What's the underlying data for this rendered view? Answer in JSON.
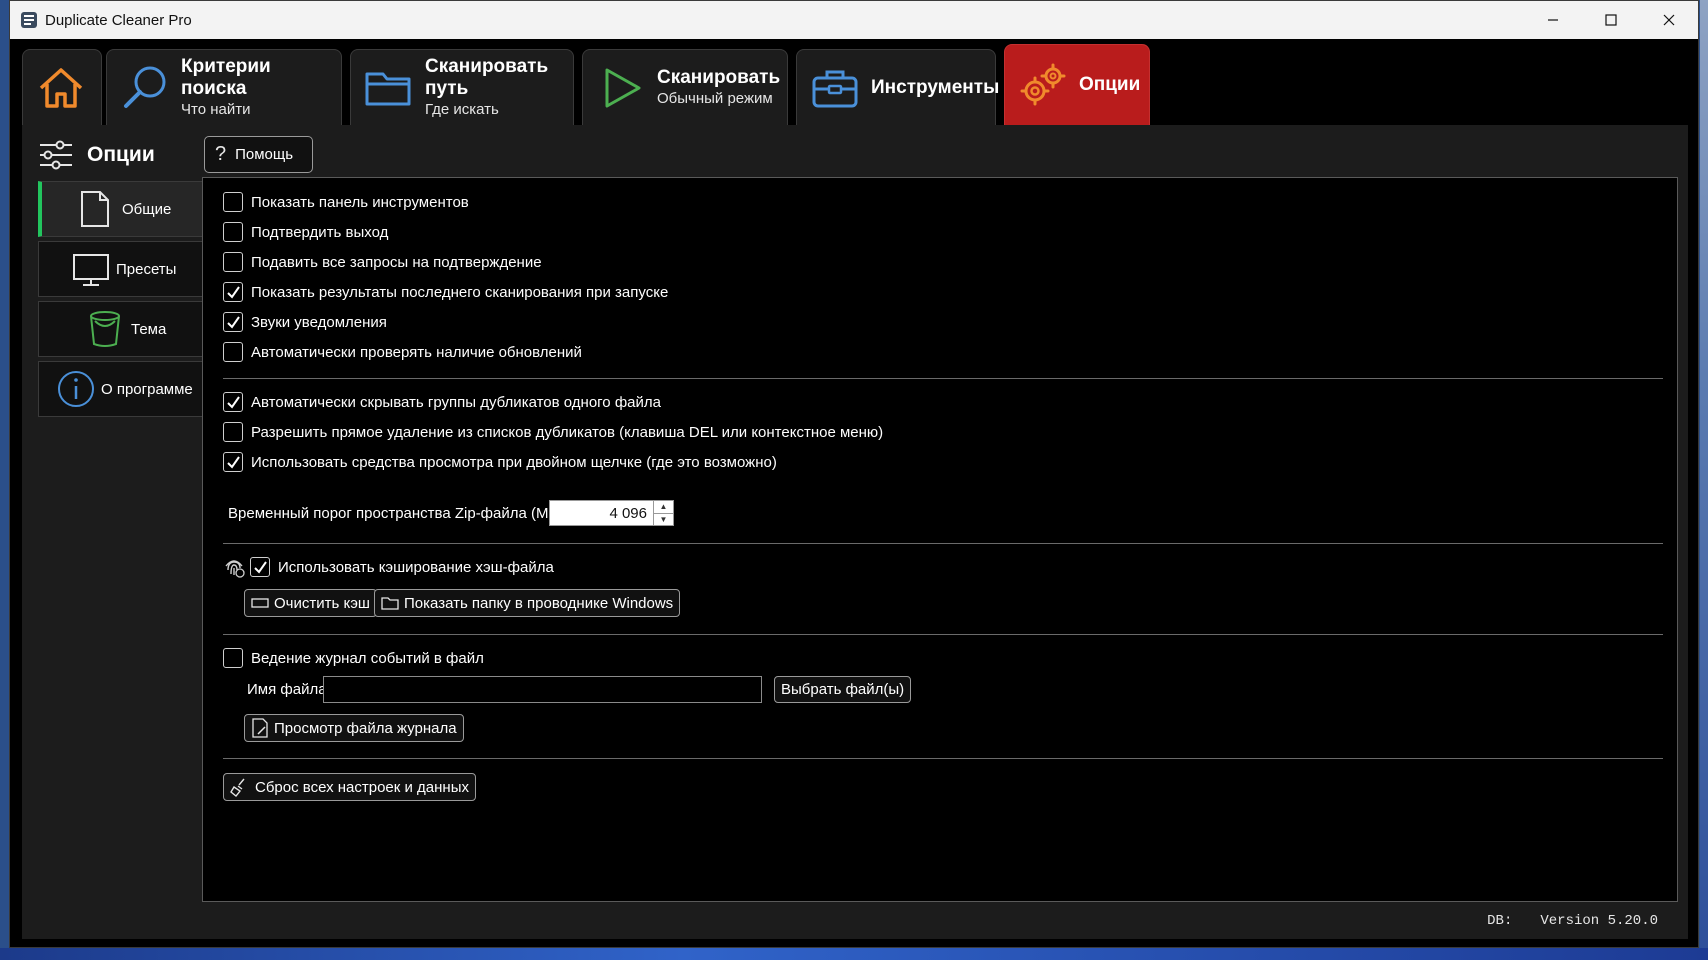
{
  "window": {
    "title": "Duplicate Cleaner Pro"
  },
  "tabs": [
    {
      "id": "home",
      "label": "",
      "sub": ""
    },
    {
      "id": "criteria",
      "label": "Критерии поиска",
      "sub": "Что найти"
    },
    {
      "id": "scan-path",
      "label": "Сканировать путь",
      "sub": "Где искать"
    },
    {
      "id": "scan",
      "label": "Сканировать",
      "sub": "Обычный режим"
    },
    {
      "id": "tools",
      "label": "Инструменты",
      "sub": ""
    },
    {
      "id": "options",
      "label": "Опции",
      "sub": ""
    }
  ],
  "header": {
    "title": "Опции",
    "help_label": "Помощь"
  },
  "sidebar": {
    "items": [
      {
        "label": "Общие",
        "icon": "document-icon",
        "active": true
      },
      {
        "label": "Пресеты",
        "icon": "monitor-icon",
        "active": false
      },
      {
        "label": "Тема",
        "icon": "paint-bucket-icon",
        "active": false
      },
      {
        "label": "О программе",
        "icon": "info-icon",
        "active": false
      }
    ]
  },
  "general": {
    "checkboxes": [
      {
        "label": "Показать панель инструментов",
        "checked": false
      },
      {
        "label": "Подтвердить выход",
        "checked": false
      },
      {
        "label": "Подавить все запросы на подтверждение",
        "checked": false
      },
      {
        "label": "Показать результаты последнего сканирования при запуске",
        "checked": true
      },
      {
        "label": "Звуки уведомления",
        "checked": true
      },
      {
        "label": "Автоматически проверять наличие обновлений",
        "checked": false
      },
      {
        "label": "Автоматически скрывать группы дубликатов одного файла",
        "checked": true
      },
      {
        "label": "Разрешить прямое удаление из списков дубликатов (клавиша DEL или контекстное меню)",
        "checked": false
      },
      {
        "label": "Использовать средства просмотра при двойном щелчке (где это возможно)",
        "checked": true
      }
    ],
    "zip_threshold": {
      "label": "Временный порог пространства Zip-файла (MB)",
      "value": "4 096"
    },
    "hash_cache": {
      "label": "Использовать кэширование хэш-файла",
      "checked": true,
      "clear_label": "Очистить кэш",
      "show_folder_label": "Показать папку в проводнике Windows"
    },
    "logging": {
      "label": "Ведение журнал событий в файл",
      "checked": false,
      "filename_label": "Имя файла",
      "filename_value": "",
      "choose_label": "Выбрать файл(ы)",
      "view_label": "Просмотр файла журнала"
    },
    "reset_label": "Сброс всех настроек и данных"
  },
  "status": {
    "db": "DB:",
    "version": "Version 5.20.0"
  },
  "colors": {
    "accent_active_tab": "#b91c1c",
    "active_side_marker": "#22c55e",
    "icon_orange": "#f08a2c",
    "icon_blue": "#4a90d9"
  }
}
